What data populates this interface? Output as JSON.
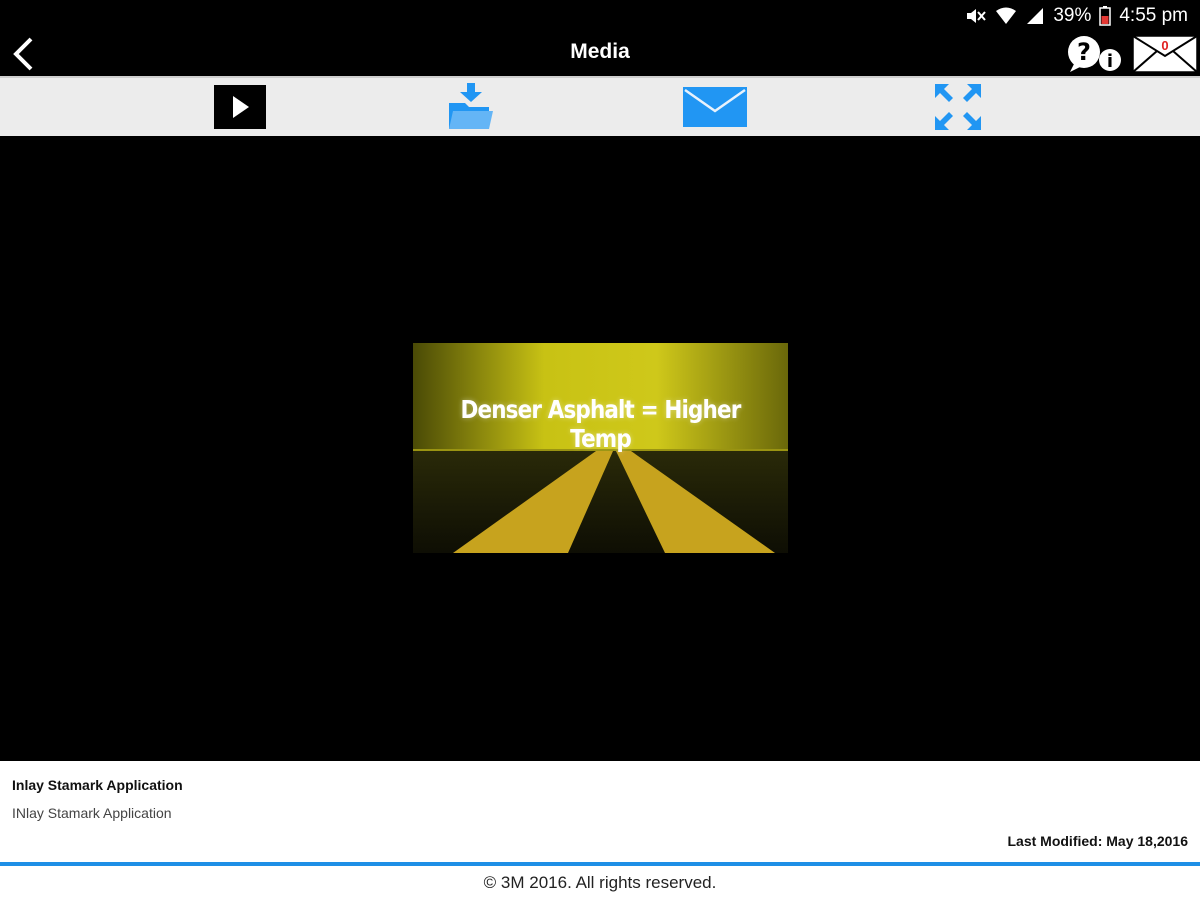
{
  "status_bar": {
    "battery": "39%",
    "time": "4:55 pm",
    "icons": [
      "mute-icon",
      "wifi-icon",
      "signal-icon",
      "battery-icon"
    ]
  },
  "header": {
    "title": "Media",
    "mail_count": "0",
    "icons": [
      "back-icon",
      "help-info-icon",
      "mail-icon"
    ]
  },
  "toolbar": {
    "icons": [
      "play-icon",
      "download-folder-icon",
      "email-icon",
      "fullscreen-icon"
    ],
    "accent": "#2196f3"
  },
  "video": {
    "thumbnail_text": "Denser Asphalt = Higher Temp"
  },
  "info": {
    "title": "Inlay Stamark Application",
    "description": "INlay Stamark Application",
    "last_modified": "Last Modified: May 18,2016"
  },
  "footer": {
    "copyright": "© 3M 2016. All rights reserved."
  }
}
